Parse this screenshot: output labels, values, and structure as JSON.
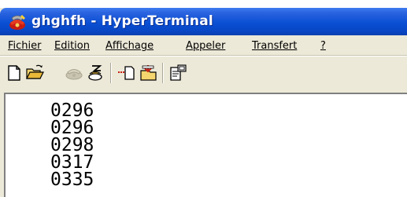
{
  "window": {
    "title": "ghghfh - HyperTerminal",
    "app_icon": "hyperterminal-phone-icon"
  },
  "menu": {
    "items": [
      {
        "label": "Fichier"
      },
      {
        "label": "Edition"
      },
      {
        "label": "Affichage"
      },
      {
        "label": "Appeler"
      },
      {
        "label": "Transfert"
      },
      {
        "label": "?"
      }
    ]
  },
  "toolbar": {
    "buttons": [
      {
        "name": "new-connection-icon",
        "enabled": true
      },
      {
        "name": "open-folder-icon",
        "enabled": true
      },
      {
        "name": "call-icon",
        "enabled": false
      },
      {
        "name": "disconnect-icon",
        "enabled": true
      },
      {
        "name": "send-icon",
        "enabled": true
      },
      {
        "name": "receive-icon",
        "enabled": true
      },
      {
        "name": "properties-icon",
        "enabled": true
      }
    ]
  },
  "terminal": {
    "lines": [
      "0296",
      "0296",
      "0298",
      "0317",
      "0335"
    ]
  },
  "colors": {
    "titlebar": "#0a4fd4",
    "chrome": "#ece9d8",
    "terminal_bg": "#ffffff",
    "terminal_text": "#000000"
  }
}
